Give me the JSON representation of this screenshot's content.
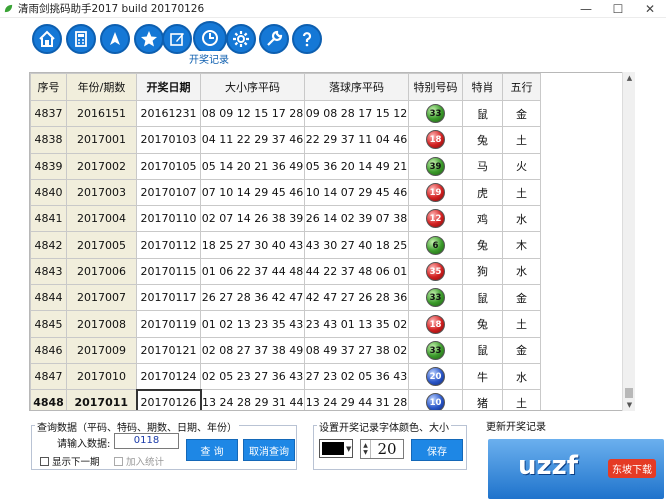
{
  "window": {
    "title": "清雨剑挑码助手2017 build 20170126",
    "minimize": "—",
    "maximize": "☐",
    "close": "✕"
  },
  "toolbar": {
    "buttons": [
      {
        "icon": "home-icon"
      },
      {
        "icon": "calculator-icon"
      },
      {
        "icon": "navigation-arrow-icon"
      },
      {
        "icon": "star-icon"
      },
      {
        "icon": "edit-icon"
      },
      {
        "icon": "clock-icon"
      },
      {
        "icon": "settings-gear-icon"
      },
      {
        "icon": "wrench-icon"
      },
      {
        "icon": "help-question-icon"
      }
    ],
    "active_label": "开奖记录"
  },
  "table": {
    "headers": [
      "序号",
      "年份/期数",
      "开奖日期",
      "大小序平码",
      "落球序平码",
      "特别号码",
      "特肖",
      "五行"
    ],
    "rows": [
      {
        "seq": "4837",
        "period": "2016151",
        "date": "20161231",
        "size": "08 09 12 15 17 28",
        "drop": "09 08 28 17 15 12",
        "special": "33",
        "color": "green",
        "zodiac": "鼠",
        "element": "金"
      },
      {
        "seq": "4838",
        "period": "2017001",
        "date": "20170103",
        "size": "04 11 22 29 37 46",
        "drop": "22 29 37 11 04 46",
        "special": "18",
        "color": "red",
        "zodiac": "兔",
        "element": "土"
      },
      {
        "seq": "4839",
        "period": "2017002",
        "date": "20170105",
        "size": "05 14 20 21 36 49",
        "drop": "05 36 20 14 49 21",
        "special": "39",
        "color": "green",
        "zodiac": "马",
        "element": "火"
      },
      {
        "seq": "4840",
        "period": "2017003",
        "date": "20170107",
        "size": "07 10 14 29 45 46",
        "drop": "10 14 07 29 45 46",
        "special": "19",
        "color": "red",
        "zodiac": "虎",
        "element": "土"
      },
      {
        "seq": "4841",
        "period": "2017004",
        "date": "20170110",
        "size": "02 07 14 26 38 39",
        "drop": "26 14 02 39 07 38",
        "special": "12",
        "color": "red",
        "zodiac": "鸡",
        "element": "水"
      },
      {
        "seq": "4842",
        "period": "2017005",
        "date": "20170112",
        "size": "18 25 27 30 40 43",
        "drop": "43 30 27 40 18 25",
        "special": "6",
        "color": "green",
        "zodiac": "兔",
        "element": "木"
      },
      {
        "seq": "4843",
        "period": "2017006",
        "date": "20170115",
        "size": "01 06 22 37 44 48",
        "drop": "44 22 37 48 06 01",
        "special": "35",
        "color": "red",
        "zodiac": "狗",
        "element": "水"
      },
      {
        "seq": "4844",
        "period": "2017007",
        "date": "20170117",
        "size": "26 27 28 36 42 47",
        "drop": "42 47 27 26 28 36",
        "special": "33",
        "color": "green",
        "zodiac": "鼠",
        "element": "金"
      },
      {
        "seq": "4845",
        "period": "2017008",
        "date": "20170119",
        "size": "01 02 13 23 35 43",
        "drop": "23 43 01 13 35 02",
        "special": "18",
        "color": "red",
        "zodiac": "兔",
        "element": "土"
      },
      {
        "seq": "4846",
        "period": "2017009",
        "date": "20170121",
        "size": "02 08 27 37 38 49",
        "drop": "08 49 37 27 38 02",
        "special": "33",
        "color": "green",
        "zodiac": "鼠",
        "element": "金"
      },
      {
        "seq": "4847",
        "period": "2017010",
        "date": "20170124",
        "size": "02 05 23 27 36 43",
        "drop": "27 23 02 05 36 43",
        "special": "20",
        "color": "blue",
        "zodiac": "牛",
        "element": "水"
      },
      {
        "seq": "4848",
        "period": "2017011",
        "date": "20170126",
        "size": "13 24 28 29 31 44",
        "drop": "13 24 29 44 31 28",
        "special": "10",
        "color": "blue",
        "zodiac": "猪",
        "element": "土"
      }
    ]
  },
  "query": {
    "group_label": "查询数据（平码、特码、期数、日期、年份）",
    "input_label": "请输入数据:",
    "input_value": "0118",
    "show_next_label": "显示下一期",
    "add_stats_label": "加入统计",
    "query_button": "查 询",
    "cancel_button": "取消查询"
  },
  "font_settings": {
    "group_label": "设置开奖记录字体颜色、大小",
    "font_color": "#000000",
    "font_size": "20",
    "save_button": "保存"
  },
  "update": {
    "group_label": "更新开奖记录",
    "image_text": "uzzf",
    "badge_text": "东坡下载"
  },
  "colors": {
    "accent": "#1e87e5",
    "ball_green": "#3a9a2a",
    "ball_red": "#d22020",
    "ball_blue": "#2a56c8"
  }
}
